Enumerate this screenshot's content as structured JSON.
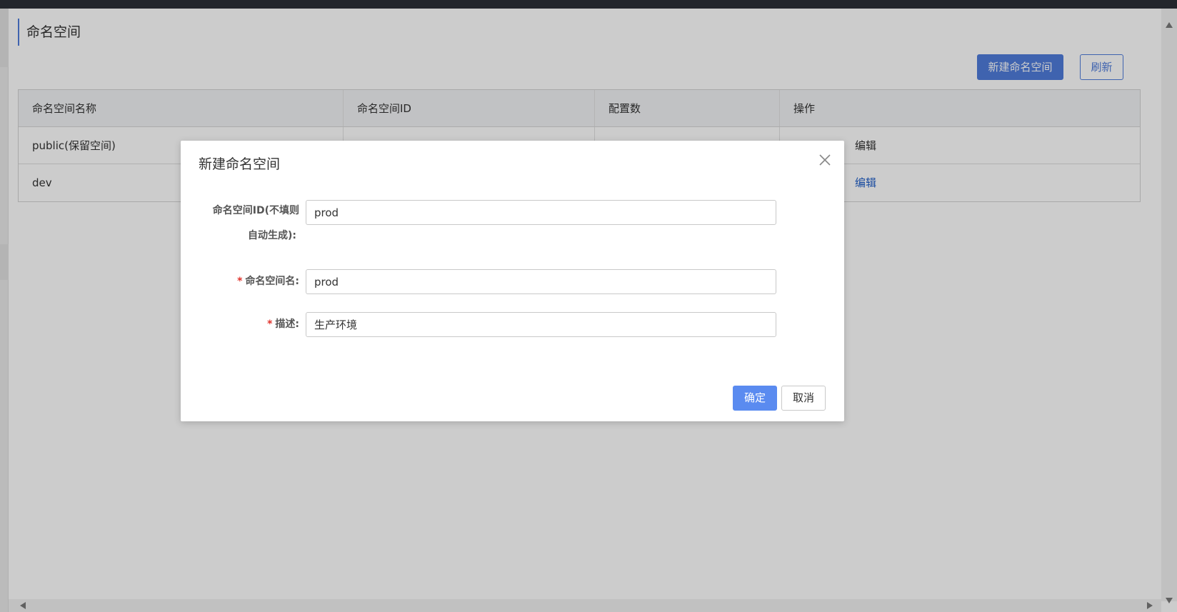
{
  "page": {
    "title": "命名空间",
    "new_button": "新建命名空间",
    "refresh_button": "刷新"
  },
  "table": {
    "headers": [
      "命名空间名称",
      "命名空间ID",
      "配置数",
      "操作"
    ],
    "rows": [
      {
        "name": "public(保留空间)",
        "edit": "编辑"
      },
      {
        "name": "dev",
        "edit": "编辑"
      }
    ]
  },
  "dialog": {
    "title": "新建命名空间",
    "id_label_line1": "命名空间ID(不填则",
    "id_label_line2": "自动生成):",
    "id_value": "prod",
    "name_label": "命名空间名:",
    "name_value": "prod",
    "desc_label": "描述:",
    "desc_value": "生产环境",
    "required_mark": "*",
    "ok_button": "确定",
    "cancel_button": "取消"
  },
  "colors": {
    "primary": "#4f7cdb",
    "link": "#2160c8",
    "required": "#e0322b"
  }
}
